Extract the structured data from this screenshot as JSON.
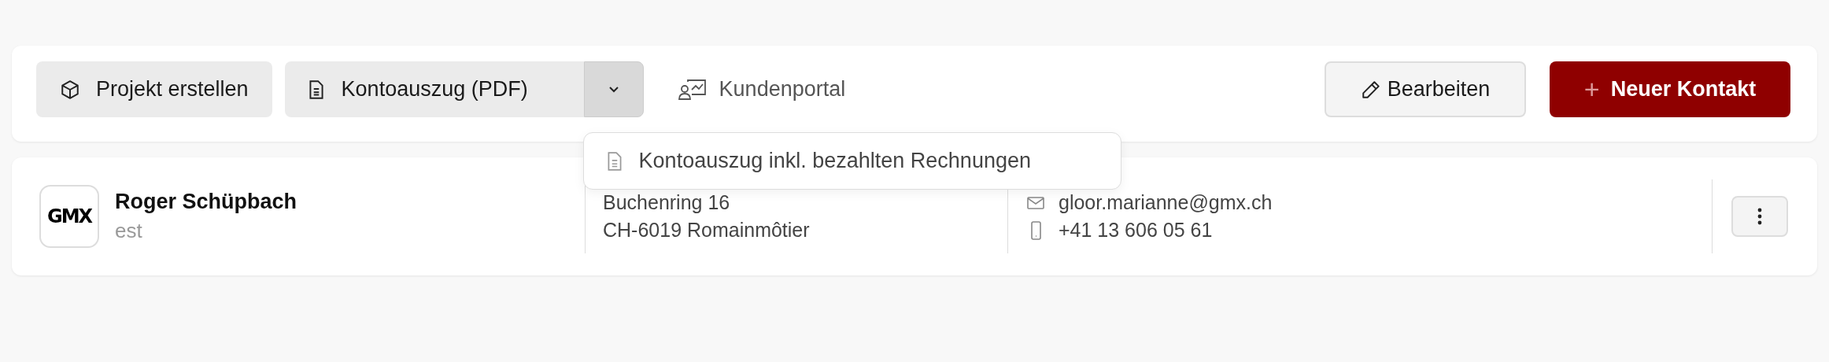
{
  "toolbar": {
    "actions": [
      {
        "kind": "create-project",
        "label": "Projekt erstellen"
      }
    ],
    "split_button": {
      "label": "Kontoauszug (PDF)",
      "expanded": true,
      "menu": [
        {
          "label": "Kontoauszug inkl. bezahlten Rechnungen"
        }
      ]
    },
    "link": {
      "label": "Kundenportal"
    },
    "edit_button": {
      "label": "Bearbeiten"
    },
    "primary_button": {
      "icon": "+",
      "label": "Neuer Kontakt"
    }
  },
  "contact": {
    "logo": "GMX",
    "name": "Roger Schüpbach",
    "subtitle": "est",
    "address": [
      "Buchenring 16",
      "CH-6019 Romainmôtier"
    ],
    "email": "gloor.marianne@gmx.ch",
    "phone": "+41 13 606 05 61"
  }
}
